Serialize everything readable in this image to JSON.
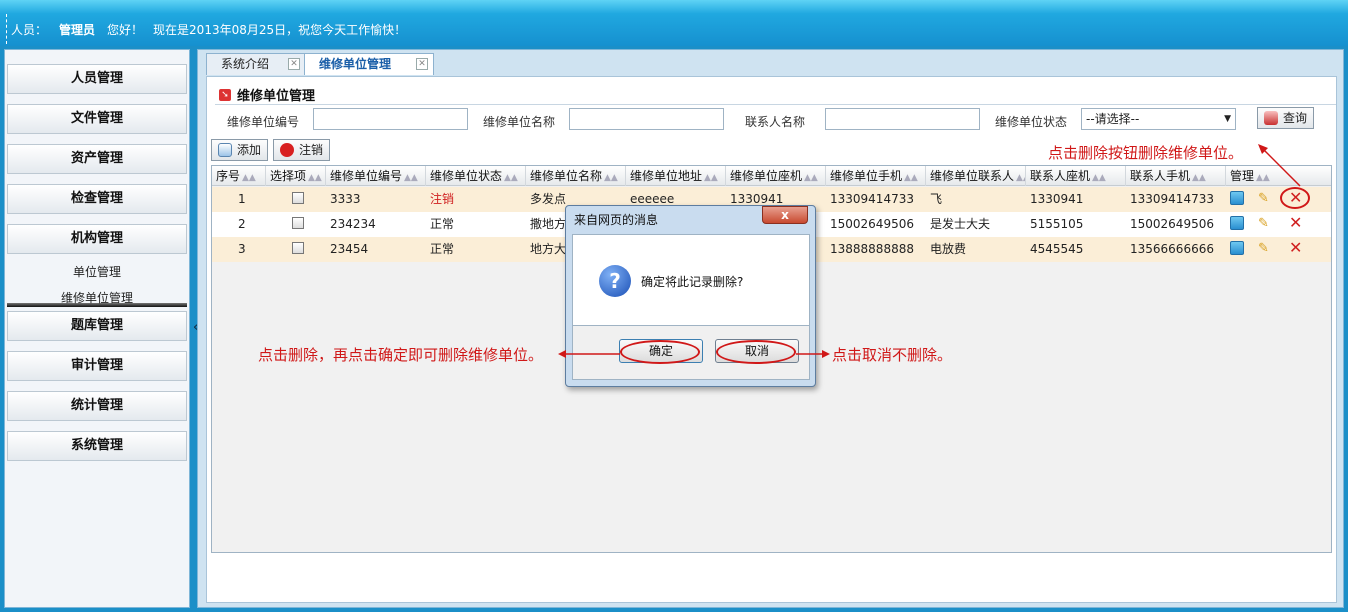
{
  "header": {
    "user_label": "人员：",
    "user_name": "管理员",
    "greeting": "您好！",
    "date_text": "现在是2013年08月25日，祝您今天工作愉快！"
  },
  "sidebar": {
    "items": [
      {
        "label": "人员管理"
      },
      {
        "label": "文件管理"
      },
      {
        "label": "资产管理"
      },
      {
        "label": "检查管理"
      },
      {
        "label": "机构管理"
      },
      {
        "label": "题库管理"
      },
      {
        "label": "审计管理"
      },
      {
        "label": "统计管理"
      },
      {
        "label": "系统管理"
      }
    ],
    "subitems": [
      {
        "label": "单位管理"
      },
      {
        "label": "维修单位管理"
      }
    ],
    "collapse_glyph": "«"
  },
  "tabs": [
    {
      "label": "系统介绍",
      "active": false
    },
    {
      "label": "维修单位管理",
      "active": true
    }
  ],
  "panel": {
    "title": "维修单位管理",
    "filters": {
      "code_label": "维修单位编号",
      "name_label": "维修单位名称",
      "contact_label": "联系人名称",
      "status_label": "维修单位状态",
      "status_value": "--请选择--",
      "query_button": "查询"
    },
    "toolbar": {
      "add_label": "添加",
      "cancel_label": "注销"
    }
  },
  "table": {
    "columns": [
      "序号",
      "选择项",
      "维修单位编号",
      "维修单位状态",
      "维修单位名称",
      "维修单位地址",
      "维修单位座机",
      "维修单位手机",
      "维修单位联系人",
      "联系人座机",
      "联系人手机",
      "管理"
    ],
    "rows": [
      {
        "no": "1",
        "code": "3333",
        "status": "注销",
        "name": "多发点",
        "address": "eeeeee",
        "phone": "1330941",
        "mobile": "13309414733",
        "contact": "飞",
        "contact_phone": "1330941",
        "contact_mobile": "13309414733"
      },
      {
        "no": "2",
        "code": "234234",
        "status": "正常",
        "name": "撒地方",
        "address": "",
        "phone": "",
        "mobile": "15002649506",
        "contact": "是发士大夫",
        "contact_phone": "5155105",
        "contact_mobile": "15002649506"
      },
      {
        "no": "3",
        "code": "23454",
        "status": "正常",
        "name": "地方大",
        "address": "",
        "phone": "",
        "mobile": "13888888888",
        "contact": "电放费",
        "contact_phone": "4545545",
        "contact_mobile": "13566666666"
      }
    ],
    "status_colors": {
      "cancelled": "#d02020",
      "normal": "#222222"
    }
  },
  "dialog": {
    "title": "来自网页的消息",
    "close_glyph": "x",
    "message": "确定将此记录删除?",
    "ok_label": "确定",
    "cancel_label": "取消"
  },
  "annotations": {
    "delete_hint": "点击删除按钮删除维修单位。",
    "confirm_hint": "点击删除，再点击确定即可删除维修单位。",
    "cancel_hint": "点击取消不删除。",
    "color": "#d01818"
  }
}
